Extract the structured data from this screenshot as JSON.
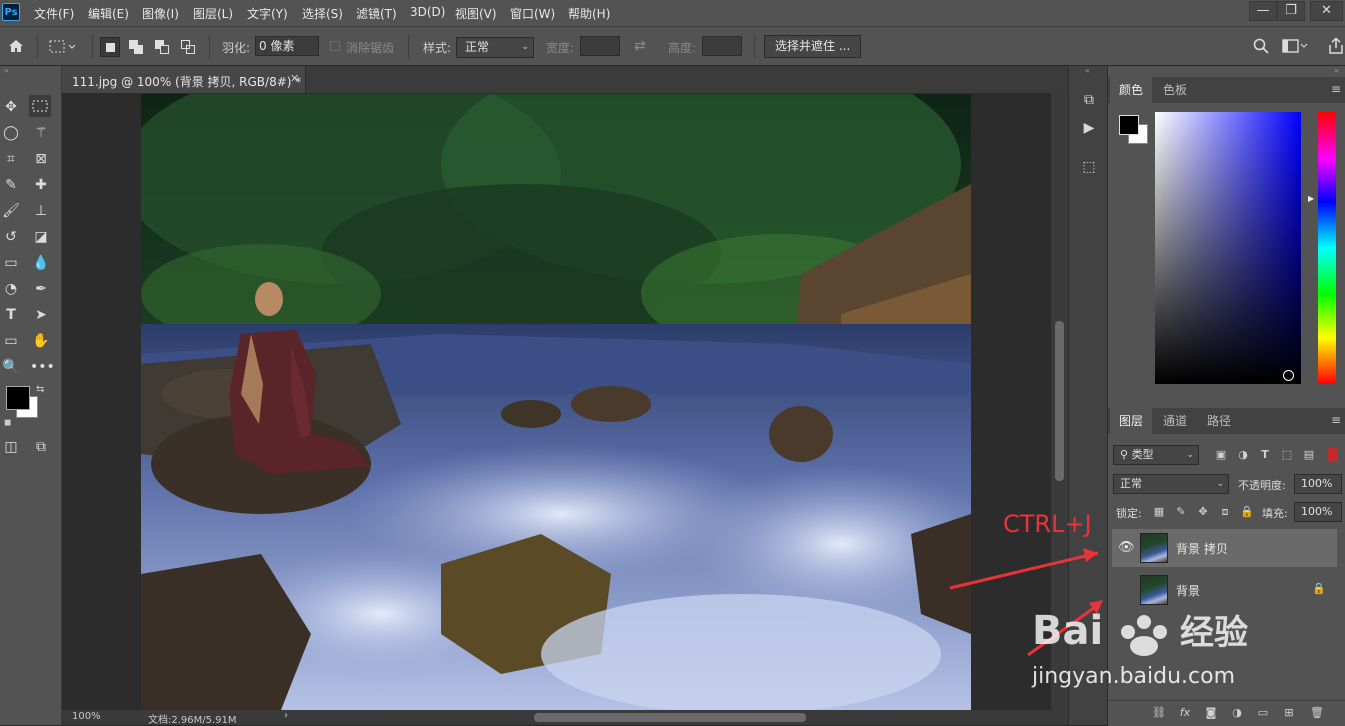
{
  "app": {
    "logo": "Ps"
  },
  "menu": [
    "文件(F)",
    "编辑(E)",
    "图像(I)",
    "图层(L)",
    "文字(Y)",
    "选择(S)",
    "滤镜(T)",
    "3D(D)",
    "视图(V)",
    "窗口(W)",
    "帮助(H)"
  ],
  "window_controls": {
    "minimize": "—",
    "restore": "❐",
    "close": "✕"
  },
  "options": {
    "feather_label": "羽化:",
    "feather_value": "0 像素",
    "antialias_label": "消除锯齿",
    "style_label": "样式:",
    "style_value": "正常",
    "width_label": "宽度:",
    "height_label": "高度:",
    "select_mask_button": "选择并遮住 ..."
  },
  "document": {
    "tab_title": "111.jpg @ 100% (背景 拷贝, RGB/8#) *",
    "zoom": "100%",
    "doc_size": "文档:2.96M/5.91M"
  },
  "color_panel": {
    "tabs": [
      "颜色",
      "色板"
    ],
    "foreground": "#000000",
    "background": "#ffffff"
  },
  "layers_panel": {
    "tabs": [
      "图层",
      "通道",
      "路径"
    ],
    "filter_kind": "类型",
    "blend_mode": "正常",
    "opacity_label": "不透明度:",
    "opacity_value": "100%",
    "lock_label": "锁定:",
    "fill_label": "填充:",
    "fill_value": "100%",
    "layers": [
      {
        "name": "背景 拷贝",
        "visible": true,
        "selected": true
      },
      {
        "name": "背景",
        "visible": false,
        "locked": true
      }
    ]
  },
  "annotation": {
    "text": "CTRL+J",
    "color": "#e8333a"
  },
  "watermark": {
    "brand": "Baidu经验",
    "url": "jingyan.baidu.com"
  },
  "colors": {
    "ui_bg": "#535353",
    "canvas_bg": "#282828",
    "accent_blue": "#31a8ff"
  }
}
